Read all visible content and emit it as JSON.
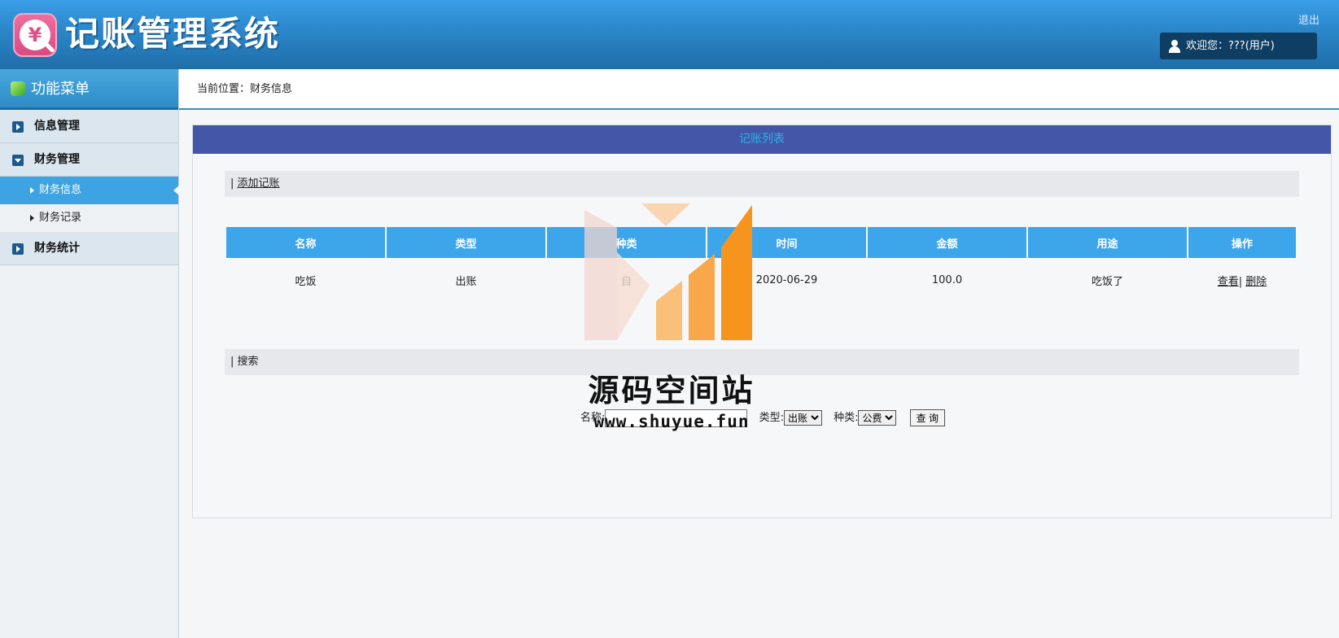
{
  "header": {
    "logo_symbol": "¥",
    "app_title": "记账管理系统",
    "logout": "退出",
    "welcome": "欢迎您：???(用户)"
  },
  "sidebar": {
    "title": "功能菜单",
    "groups": [
      {
        "label": "信息管理",
        "expanded": false
      },
      {
        "label": "财务管理",
        "expanded": true,
        "items": [
          {
            "label": "财务信息",
            "active": true
          },
          {
            "label": "财务记录",
            "active": false
          }
        ]
      },
      {
        "label": "财务统计",
        "expanded": false
      }
    ]
  },
  "breadcrumb": "当前位置：财务信息",
  "panel": {
    "title": "记账列表",
    "add_prefix": "| ",
    "add_link": "添加记账",
    "table": {
      "headers": [
        "名称",
        "类型",
        "种类",
        "时间",
        "金额",
        "用途",
        "操作"
      ],
      "rows": [
        {
          "name": "吃饭",
          "type": "出账",
          "kind": "自",
          "time": "2020-06-29",
          "amount": "100.0",
          "purpose": "吃饭了",
          "actions": {
            "view": "查看",
            "sep": "|",
            "delete": "删除"
          }
        }
      ]
    },
    "search": {
      "bar_label": "| 搜索",
      "name_label": "名称:",
      "name_value": "",
      "type_label": "类型:",
      "type_selected": "出账",
      "kind_label": "种类:",
      "kind_selected": "公费",
      "query_button": "查 询"
    }
  },
  "watermark": {
    "title": "源码空间站",
    "url": "www.shuyue.fun"
  },
  "colors": {
    "header": "#2b86c9",
    "panel_title_bg": "#4356a8",
    "table_header": "#3da5ea",
    "active_menu": "#3ea3e2",
    "watermark_orange": "#f7941d"
  }
}
